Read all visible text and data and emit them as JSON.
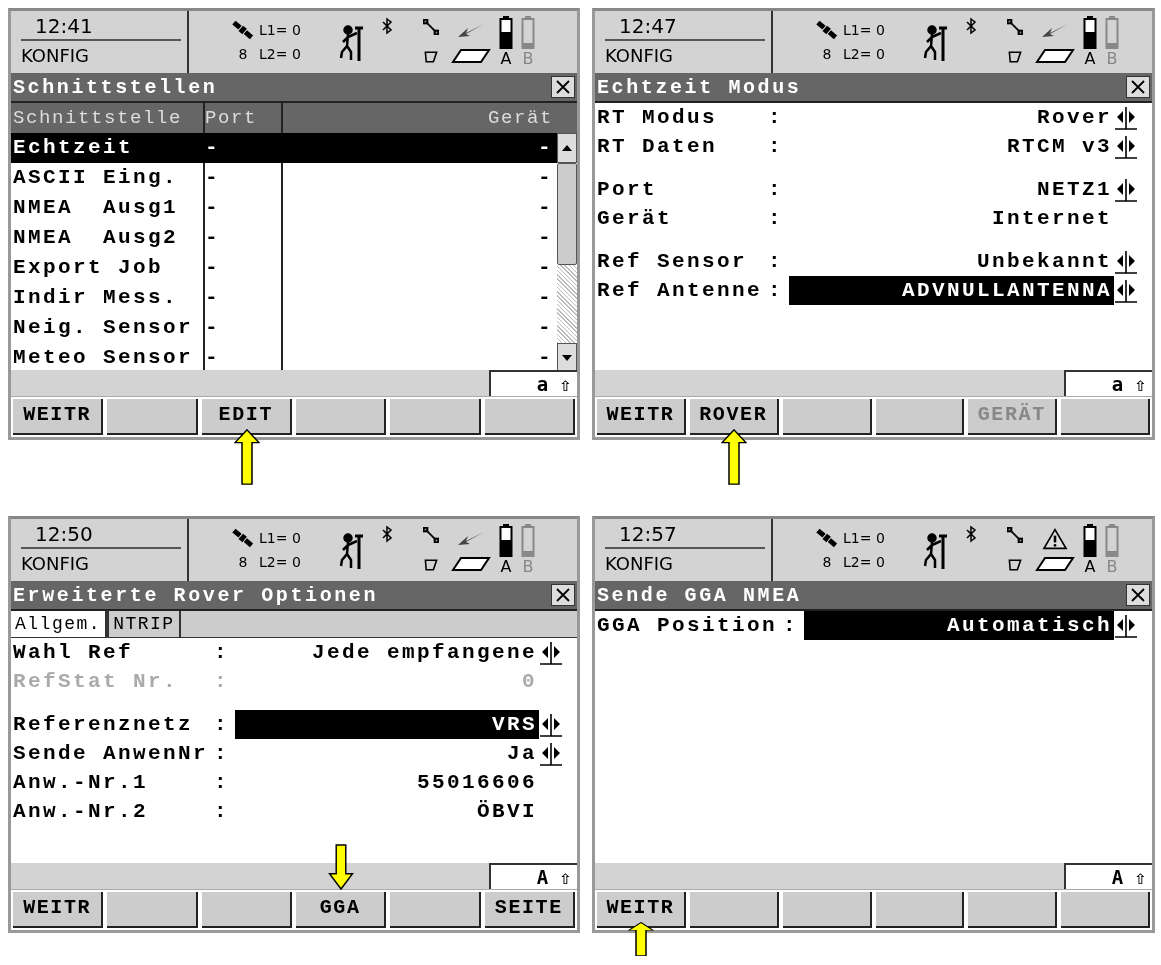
{
  "screens": [
    {
      "status": {
        "time": "12:41",
        "mode": "KONFIG",
        "satellites": "8",
        "l1": "L1= 0",
        "l2": "L2= 0",
        "battery_a": "A",
        "battery_b": "B",
        "alert": false
      },
      "title": "Schnittstellen",
      "content": {
        "kind": "table",
        "columns": [
          "Schnittstelle",
          "Port",
          "Gerät"
        ],
        "rows": [
          {
            "name": "Echtzeit",
            "port": "-",
            "device": "-",
            "selected": true
          },
          {
            "name": "ASCII Eing.",
            "port": "-",
            "device": "-",
            "selected": false
          },
          {
            "name": "NMEA  Ausg1",
            "port": "-",
            "device": "-",
            "selected": false
          },
          {
            "name": "NMEA  Ausg2",
            "port": "-",
            "device": "-",
            "selected": false
          },
          {
            "name": "Export Job",
            "port": "-",
            "device": "-",
            "selected": false
          },
          {
            "name": "Indir Mess.",
            "port": "-",
            "device": "-",
            "selected": false
          },
          {
            "name": "Neig. Sensor",
            "port": "-",
            "device": "-",
            "selected": false
          },
          {
            "name": "Meteo Sensor",
            "port": "-",
            "device": "-",
            "selected": false
          }
        ]
      },
      "input_mode": "a ⇧",
      "softkeys": [
        {
          "kind": "key",
          "label": "WEITR",
          "disabled": false,
          "pointer_below": false,
          "pointer_above": false
        },
        {
          "kind": "blank"
        },
        {
          "kind": "key",
          "label": "EDIT",
          "disabled": false,
          "pointer_below": true,
          "pointer_above": false
        },
        {
          "kind": "blank"
        },
        {
          "kind": "blank"
        },
        {
          "kind": "blank"
        }
      ]
    },
    {
      "status": {
        "time": "12:47",
        "mode": "KONFIG",
        "satellites": "8",
        "l1": "L1= 0",
        "l2": "L2= 0",
        "battery_a": "A",
        "battery_b": "B",
        "alert": false
      },
      "title": "Echtzeit Modus",
      "content": {
        "kind": "form",
        "groups": [
          [
            {
              "label": "RT Modus",
              "separator": ":",
              "value": "Rover",
              "kind": "choice",
              "selected": false,
              "disabled": false
            },
            {
              "label": "RT Daten",
              "separator": ":",
              "value": "RTCM v3",
              "kind": "choice",
              "selected": false,
              "disabled": false
            }
          ],
          [
            {
              "label": "Port",
              "separator": ":",
              "value": "NETZ1",
              "kind": "choice",
              "selected": false,
              "disabled": false
            },
            {
              "label": "Gerät",
              "separator": ":",
              "value": "Internet",
              "kind": "text",
              "selected": false,
              "disabled": false
            }
          ],
          [
            {
              "label": "Ref Sensor",
              "separator": ":",
              "value": "Unbekannt",
              "kind": "choice",
              "selected": false,
              "disabled": false
            },
            {
              "label": "Ref Antenne",
              "separator": ":",
              "value": "ADVNULLANTENNA",
              "kind": "choice",
              "selected": true,
              "disabled": false
            }
          ]
        ]
      },
      "input_mode": "a ⇧",
      "softkeys": [
        {
          "kind": "key",
          "label": "WEITR",
          "disabled": false,
          "pointer_below": false,
          "pointer_above": false
        },
        {
          "kind": "key",
          "label": "ROVER",
          "disabled": false,
          "pointer_below": true,
          "pointer_above": false
        },
        {
          "kind": "blank"
        },
        {
          "kind": "blank"
        },
        {
          "kind": "key",
          "label": "GERÄT",
          "disabled": true,
          "pointer_below": false,
          "pointer_above": false
        },
        {
          "kind": "blank"
        }
      ]
    },
    {
      "status": {
        "time": "12:50",
        "mode": "KONFIG",
        "satellites": "8",
        "l1": "L1= 0",
        "l2": "L2= 0",
        "battery_a": "A",
        "battery_b": "B",
        "alert": false
      },
      "title": "Erweiterte Rover Optionen",
      "tabs": [
        {
          "label": "Allgem.",
          "selected": true
        },
        {
          "label": "NTRIP",
          "selected": false
        }
      ],
      "content": {
        "kind": "form",
        "groups": [
          [
            {
              "label": "Wahl Ref",
              "separator": ":",
              "value": "Jede empfangene",
              "kind": "choice",
              "selected": false,
              "disabled": false
            },
            {
              "label": "RefStat Nr.",
              "separator": ":",
              "value": "0",
              "kind": "text",
              "selected": false,
              "disabled": true
            }
          ],
          [
            {
              "label": "Referenznetz",
              "separator": ":",
              "value": "VRS",
              "kind": "choice",
              "selected": true,
              "disabled": false
            },
            {
              "label": "Sende AnwenNr",
              "separator": ":",
              "value": "Ja",
              "kind": "choice",
              "selected": false,
              "disabled": false
            },
            {
              "label": "Anw.-Nr.1",
              "separator": ":",
              "value": "55016606",
              "kind": "text",
              "selected": false,
              "disabled": false
            },
            {
              "label": "Anw.-Nr.2",
              "separator": ":",
              "value": "ÖBVI",
              "kind": "text",
              "selected": false,
              "disabled": false
            }
          ]
        ]
      },
      "input_mode": "A ⇧",
      "softkeys": [
        {
          "kind": "key",
          "label": "WEITR",
          "disabled": false,
          "pointer_below": false,
          "pointer_above": false
        },
        {
          "kind": "blank"
        },
        {
          "kind": "blank"
        },
        {
          "kind": "key",
          "label": "GGA",
          "disabled": false,
          "pointer_below": false,
          "pointer_above": true
        },
        {
          "kind": "blank"
        },
        {
          "kind": "key",
          "label": "SEITE",
          "disabled": false,
          "pointer_below": false,
          "pointer_above": false
        }
      ]
    },
    {
      "status": {
        "time": "12:57",
        "mode": "KONFIG",
        "satellites": "8",
        "l1": "L1= 0",
        "l2": "L2= 0",
        "battery_a": "A",
        "battery_b": "B",
        "alert": true
      },
      "title": "Sende GGA NMEA",
      "content": {
        "kind": "form",
        "groups": [
          [
            {
              "label": "GGA Position",
              "separator": ":",
              "value": "Automatisch",
              "kind": "choice",
              "selected": true,
              "disabled": false
            }
          ]
        ]
      },
      "input_mode": "A ⇧",
      "softkeys": [
        {
          "kind": "key",
          "label": "WEITR",
          "disabled": false,
          "pointer_below": true,
          "pointer_above": false
        },
        {
          "kind": "blank"
        },
        {
          "kind": "blank"
        },
        {
          "kind": "blank"
        },
        {
          "kind": "blank"
        },
        {
          "kind": "blank"
        }
      ]
    }
  ]
}
